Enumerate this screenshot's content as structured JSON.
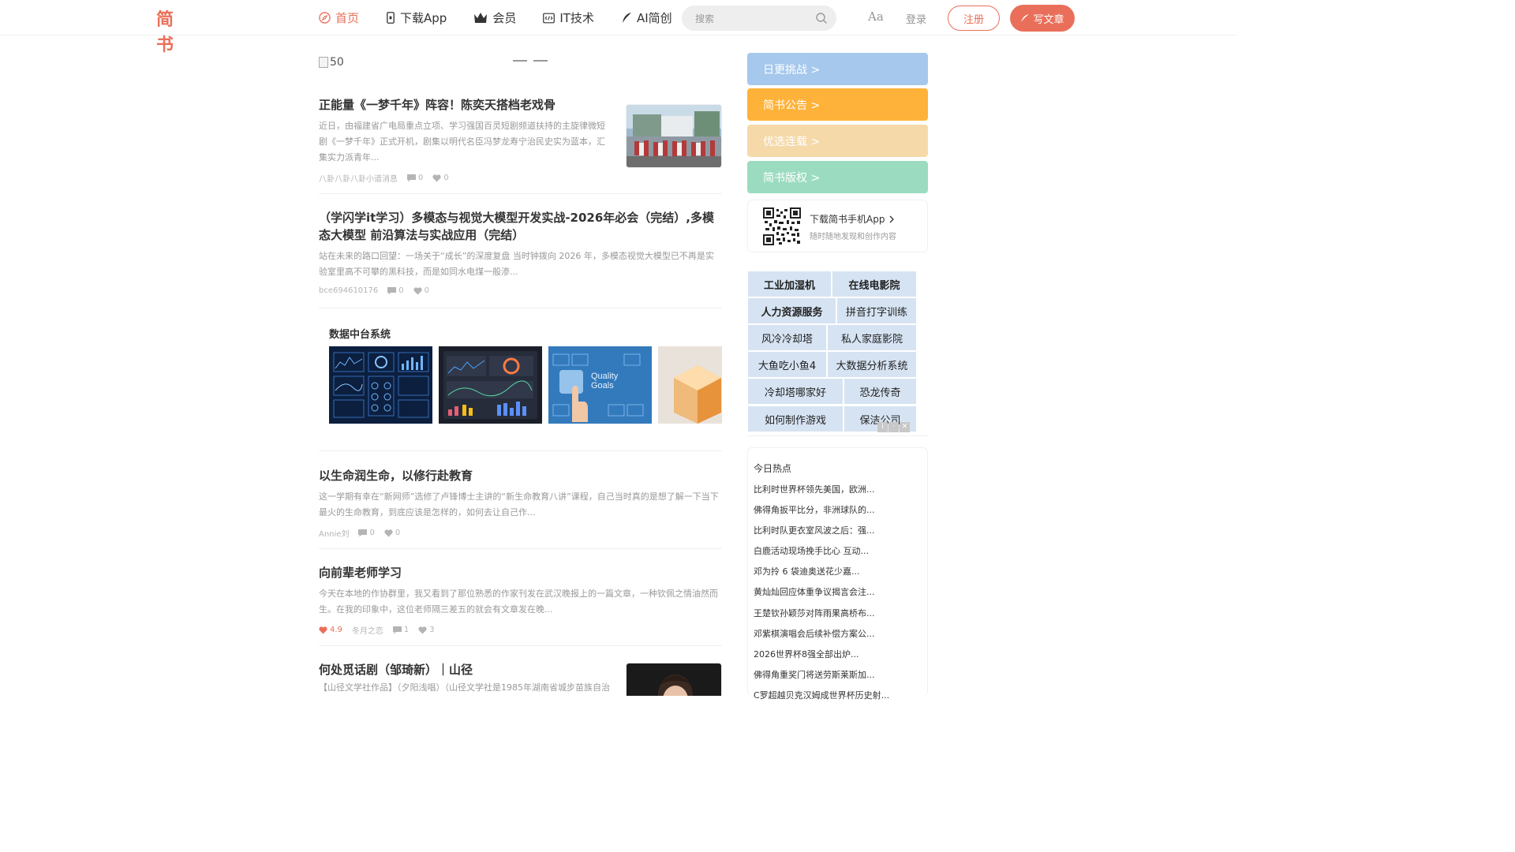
{
  "header": {
    "logo": "简书",
    "nav": [
      {
        "label": "首页",
        "icon": "compass-icon",
        "active": true
      },
      {
        "label": "下载App",
        "icon": "phone-icon",
        "active": false
      },
      {
        "label": "会员",
        "icon": "crown-icon",
        "active": false
      },
      {
        "label": "IT技术",
        "icon": "code-icon",
        "active": false
      },
      {
        "label": "AI简创",
        "icon": "feather-icon",
        "active": false
      }
    ],
    "search_placeholder": "搜索",
    "font_toggle": "Aa",
    "login": "登录",
    "signup": "注册",
    "write": "写文章"
  },
  "banner": {
    "alt": "50"
  },
  "articles": [
    {
      "title": "正能量《一梦千年》阵容！陈奕天搭档老戏骨",
      "abstract": "近日，由福建省广电局重点立项、学习强国百灵短剧频道扶持的主旋律微短剧《一梦千年》正式开机，剧集以明代名臣冯梦龙寿宁治民史实为蓝本，汇集实力派青年...",
      "author": "八卦八卦八卦小道消息",
      "comments": "0",
      "likes": "0"
    },
    {
      "title": "（学闪学it学习）多模态与视觉大模型开发实战-2026年必会（完结）,多模态大模型 前沿算法与实战应用（完结）",
      "abstract": "站在未来的路口回望：一场关于“成长”的深度复盘 当时钟拨向 2026 年，多模态视觉大模型已不再是实验室里高不可攀的黑科技，而是如同水电煤一般渗...",
      "author": "bce694610176",
      "comments": "0",
      "likes": "0"
    },
    {
      "title": "以生命润生命，以修行赴教育",
      "abstract": "这一学期有幸在“新网师”选修了卢锋博士主讲的“新生命教育八讲”课程，自己当时真的是想了解一下当下最火的生命教育，到底应该是怎样的，如何去让自己作...",
      "author": "Annie刘",
      "comments": "0",
      "likes": "0"
    },
    {
      "title": "向前辈老师学习",
      "abstract": "今天在本地的作协群里，我又看到了那位熟悉的作家刊发在武汉晚报上的一篇文章，一种钦佩之情油然而生。在我的印象中，这位老师隔三差五的就会有文章发在晚...",
      "diamond": "4.9",
      "author": "冬月之恋",
      "comments": "1",
      "likes": "3"
    },
    {
      "title": "何处觅话剧（邹琦新）｜山径",
      "abstract": "【山径文学社作品】（夕阳浅唱）（山径文学社是1985年湖南省城步苗族自治"
    }
  ],
  "ad": {
    "title": "数据中台系统",
    "image_text": "Quality Goals"
  },
  "sidebar": {
    "buttons": [
      {
        "label": "日更挑战  >",
        "color": "#a5c8ec"
      },
      {
        "label": "简书公告  >",
        "color": "#ffb239"
      },
      {
        "label": "优选连载  >",
        "color": "#f5d9a9"
      },
      {
        "label": "简书版权  >",
        "color": "#9bdcc1"
      }
    ],
    "app_title": "下载简书手机App",
    "app_sub": "随时随地发现和创作内容",
    "tags": [
      "工业加湿机",
      "在线电影院",
      "人力资源服务",
      "拼音打字训练",
      "风冷冷却塔",
      "私人家庭影院",
      "大鱼吃小鱼4",
      "大数据分析系统",
      "冷却塔哪家好",
      "恐龙传奇",
      "如何制作游戏",
      "保洁公司"
    ],
    "hot_title": "今日热点",
    "hot": [
      "比利时世界杯领先美国，欧洲...",
      "佛得角扳平比分，非洲球队的...",
      "比利时队更衣室风波之后：强...",
      "白鹿活动现场挽手比心 互动...",
      "邓为拎 6 袋迪奥送花少嘉...",
      "黄灿灿回应体重争议揭言会注...",
      "王楚钦孙颖莎对阵雨果高桥布...",
      "邓紫棋演唱会后续补偿方案公...",
      "2026世界杯8强全部出炉...",
      "佛得角重奖门将送劳斯莱斯加...",
      "C罗超越贝克汉姆成世界杯历史射..."
    ]
  }
}
